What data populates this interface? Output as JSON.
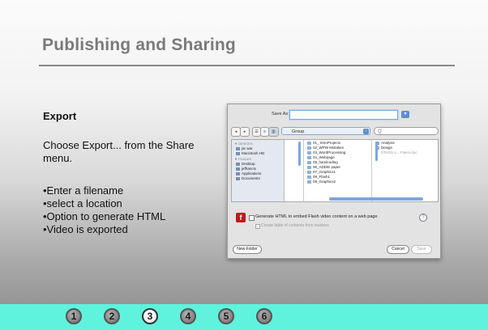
{
  "slide": {
    "title": "Publishing and Sharing",
    "subheading": "Export",
    "paragraph": "Choose Export... from the Share menu.",
    "bullets": [
      "•Enter a filename",
      "•select a location",
      "•Option to generate HTML",
      "•Video is exported"
    ]
  },
  "dialog": {
    "save_as_label": "Save As:",
    "save_as_value": "",
    "nav_back": "◂",
    "nav_forward": "▸",
    "view_modes": [
      "☰",
      "≡",
      "▥"
    ],
    "location": "Group",
    "search_placeholder": "Q",
    "sidebar": {
      "devices_header": "▼ DEVICES",
      "devices": [
        "jar war",
        "Macintosh HD"
      ],
      "places_header": "▼ PLACES",
      "places": [
        "Desktop",
        "jeffrancis",
        "Applications",
        "Documents"
      ]
    },
    "folders": [
      "01_ IntroProjects",
      "02_WPW Mistakes",
      "03_WordProcessing",
      "04_Webpage",
      "05_handcoding",
      "06_ADDIE paper",
      "07_Graphics1",
      "08_Flash1",
      "09_Graphics2"
    ],
    "subfolders": [
      "Analysis",
      "Design"
    ],
    "detail_item": "STAGS A... Flavor.doc",
    "option_generate_html": "Generate HTML to embed Flash video content on a web page",
    "option_toc": "Create table of contents from markers",
    "help_label": "?",
    "new_folder_label": "New Folder",
    "cancel_label": "Cancel",
    "save_label": "Save"
  },
  "nav": {
    "buttons": [
      "1",
      "2",
      "3",
      "4",
      "5",
      "6"
    ],
    "active": "3"
  },
  "colors": {
    "nav_bar": "#5ff3dd",
    "title": "#7a7a7a",
    "flash_icon": "#c0161d"
  }
}
